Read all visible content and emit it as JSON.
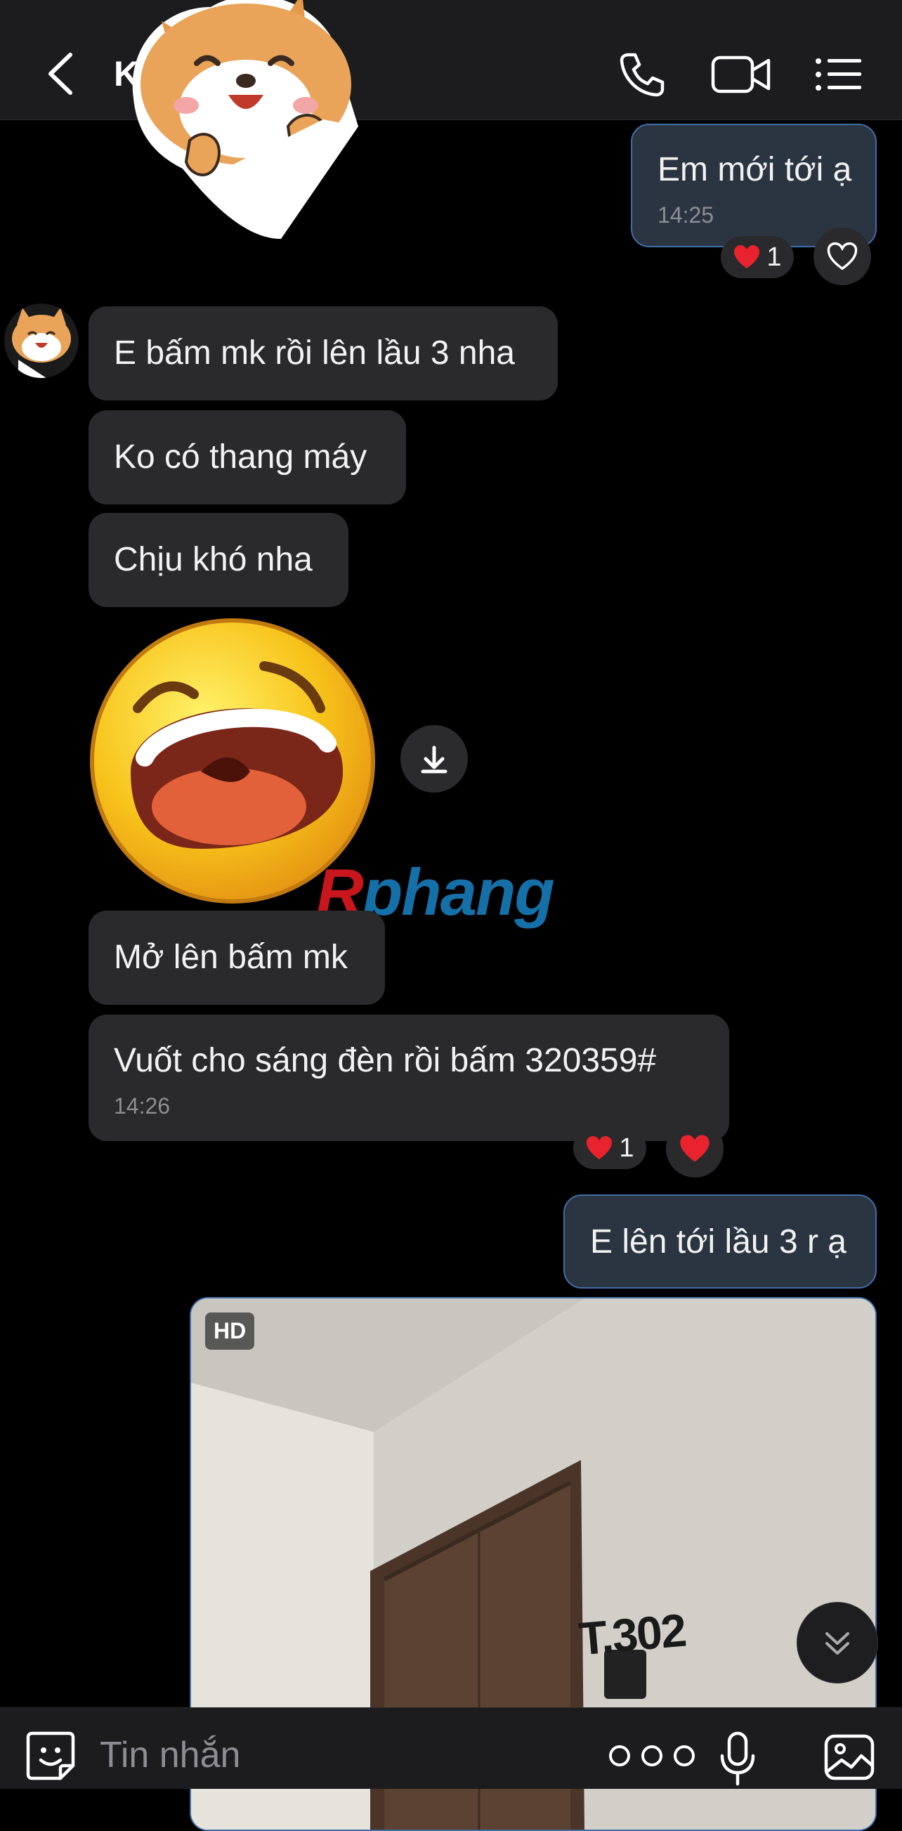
{
  "header": {
    "title": "K           n",
    "back_icon": "chevron-left-icon",
    "call_icon": "phone-icon",
    "video_icon": "video-camera-icon",
    "menu_icon": "list-menu-icon"
  },
  "messages": [
    {
      "from": "me",
      "text": "Em mới tới ạ",
      "time": "14:25",
      "reaction_count": "1"
    },
    {
      "from": "them",
      "text": "E bấm mk rồi lên lầu 3 nha"
    },
    {
      "from": "them",
      "text": "Ko có thang máy"
    },
    {
      "from": "them",
      "text": "Chịu khó nha"
    },
    {
      "from": "them",
      "type": "sticker",
      "sticker": "laughing-face"
    },
    {
      "from": "them",
      "text": "Mở lên bấm mk"
    },
    {
      "from": "them",
      "text": "Vuốt cho sáng đèn rồi bấm 320359#",
      "time": "14:26",
      "reaction_count": "1"
    },
    {
      "from": "me",
      "text": "E lên tới lầu 3 r ạ"
    },
    {
      "from": "me",
      "type": "photo",
      "badge": "HD",
      "door_sign": "T.302"
    }
  ],
  "watermark": {
    "r": "R",
    "rest": "phang"
  },
  "input": {
    "placeholder": "Tin nhắn"
  },
  "colors": {
    "background": "#000000",
    "bubble_them": "#2a2a2c",
    "bubble_me": "#2b3542",
    "bubble_me_border": "#3e6ea8",
    "heart": "#e8232e"
  }
}
